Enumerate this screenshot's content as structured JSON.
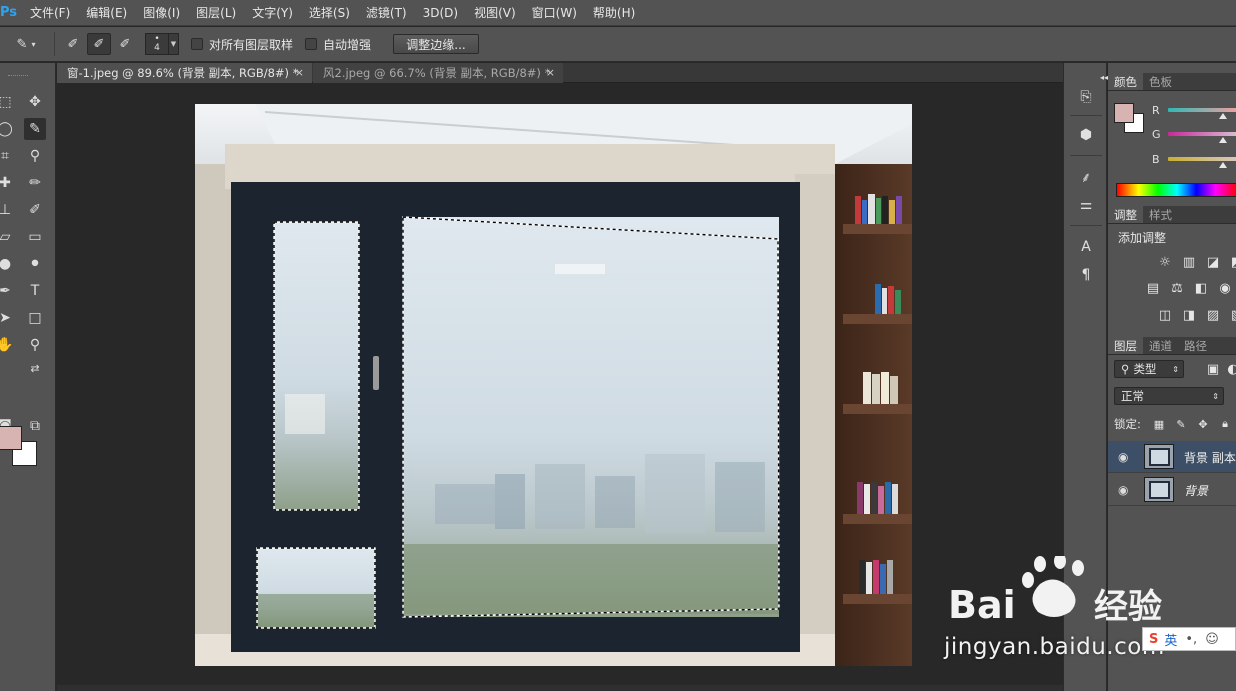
{
  "app": {
    "logo": "Ps"
  },
  "menu": [
    "文件(F)",
    "编辑(E)",
    "图像(I)",
    "图层(L)",
    "文字(Y)",
    "选择(S)",
    "滤镜(T)",
    "3D(D)",
    "视图(V)",
    "窗口(W)",
    "帮助(H)"
  ],
  "options": {
    "brush_size_top": "•",
    "brush_size": "4",
    "sample_all_layers": "对所有图层取样",
    "auto_enhance": "自动增强",
    "refine_edge": "调整边缘..."
  },
  "tabs": [
    {
      "title": "窗-1.jpeg @ 89.6% (背景 副本, RGB/8#) *",
      "active": true
    },
    {
      "title": "风2.jpeg @ 66.7% (背景 副本, RGB/8#) *",
      "active": false
    }
  ],
  "tab_close": "×",
  "colors": {
    "foreground": "#d7b3b1",
    "background": "#ffffff",
    "accent_selected_layer": "#3d4f66",
    "ps_blue": "#2fa3f0"
  },
  "color_panel": {
    "tabs": [
      "颜色",
      "色板"
    ],
    "channels": [
      "R",
      "G",
      "B"
    ]
  },
  "adjustments_panel": {
    "tabs": [
      "调整",
      "样式"
    ],
    "heading": "添加调整"
  },
  "layers_panel": {
    "tabs": [
      "图层",
      "通道",
      "路径"
    ],
    "filter_kind": "类型",
    "blend_mode": "正常",
    "lock_label": "锁定:",
    "layers": [
      {
        "name": "背景 副本",
        "selected": true,
        "italic": false
      },
      {
        "name": "背景",
        "selected": false,
        "italic": true
      }
    ]
  },
  "watermark": {
    "brand": "Bai",
    "brand2": "经验",
    "url": "jingyan.baidu.com"
  },
  "ime": {
    "label": "英"
  }
}
